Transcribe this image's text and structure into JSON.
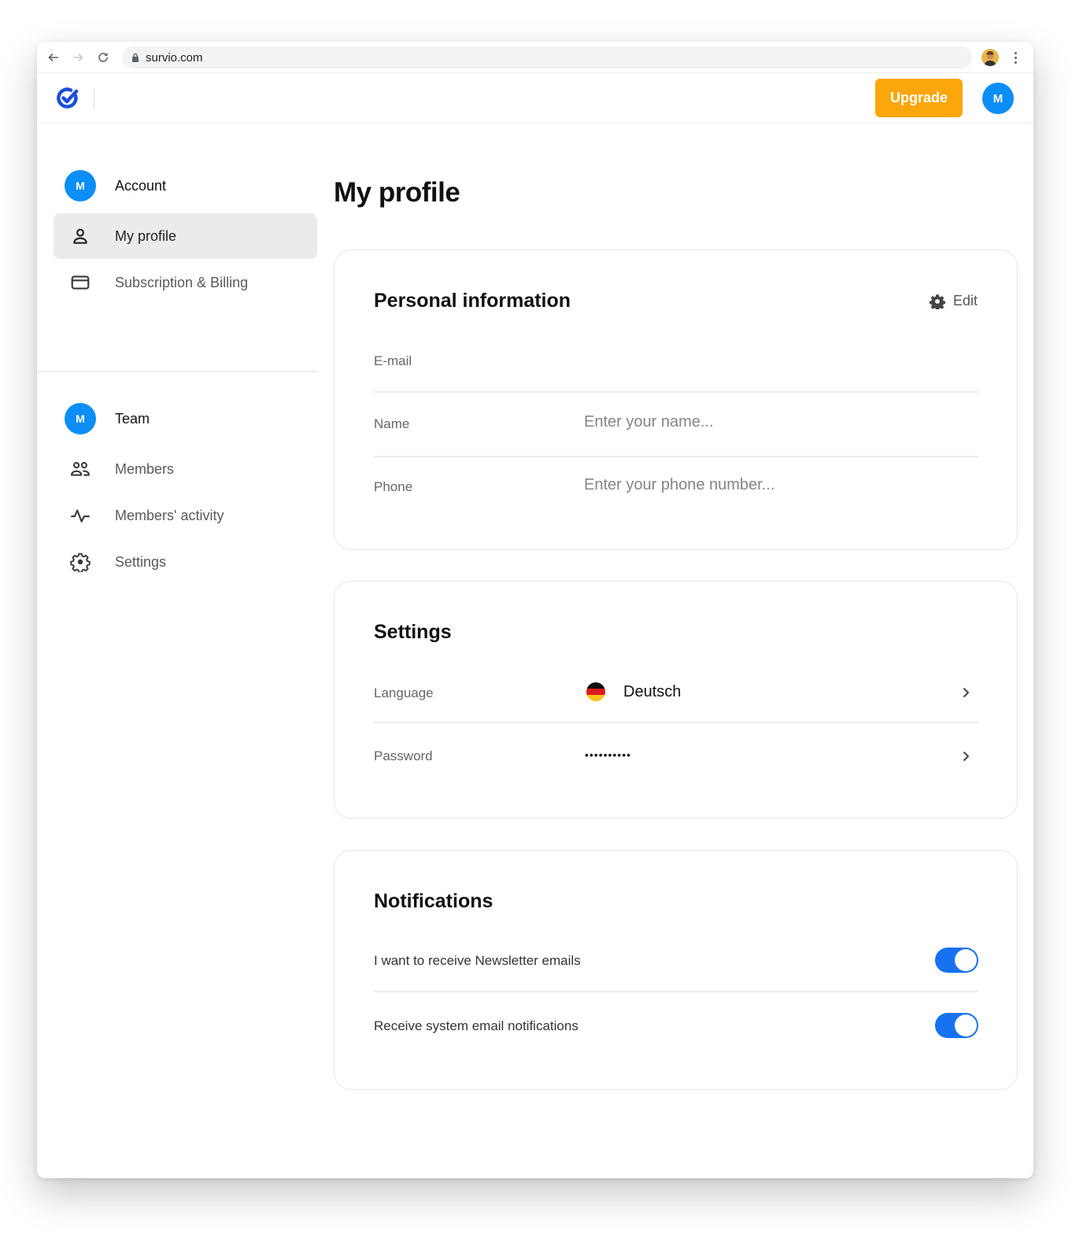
{
  "browser": {
    "url": "survio.com",
    "back_icon": "arrow-left-icon",
    "forward_icon": "arrow-right-icon",
    "reload_icon": "reload-icon",
    "lock_icon": "lock-icon",
    "menu_icon": "kebab-menu-icon"
  },
  "header": {
    "logo": "survio-check-logo",
    "upgrade_label": "Upgrade",
    "avatar_initial": "M",
    "accent_color": "#fba70c",
    "avatar_color": "#0b8ef5"
  },
  "sidebar": {
    "account": {
      "initial": "M",
      "label": "Account"
    },
    "account_items": [
      {
        "label": "My profile",
        "icon": "user-icon",
        "active": true
      },
      {
        "label": "Subscription & Billing",
        "icon": "credit-card-icon",
        "active": false
      }
    ],
    "team": {
      "initial": "M",
      "label": "Team"
    },
    "team_items": [
      {
        "label": "Members",
        "icon": "users-icon"
      },
      {
        "label": "Members' activity",
        "icon": "activity-icon"
      },
      {
        "label": "Settings",
        "icon": "gear-icon"
      }
    ]
  },
  "main": {
    "title": "My profile",
    "personal": {
      "title": "Personal information",
      "edit_label": "Edit",
      "email_label": "E-mail",
      "email_value": "",
      "name_label": "Name",
      "name_placeholder": "Enter your name...",
      "phone_label": "Phone",
      "phone_placeholder": "Enter your phone number..."
    },
    "settings": {
      "title": "Settings",
      "language_label": "Language",
      "language_value": "Deutsch",
      "language_flag": "germany-flag",
      "password_label": "Password",
      "password_value": "••••••••••"
    },
    "notifications": {
      "title": "Notifications",
      "newsletter_label": "I want to receive Newsletter emails",
      "newsletter_on": true,
      "system_label": "Receive system email notifications",
      "system_on": true,
      "toggle_color": "#1672f0"
    }
  }
}
